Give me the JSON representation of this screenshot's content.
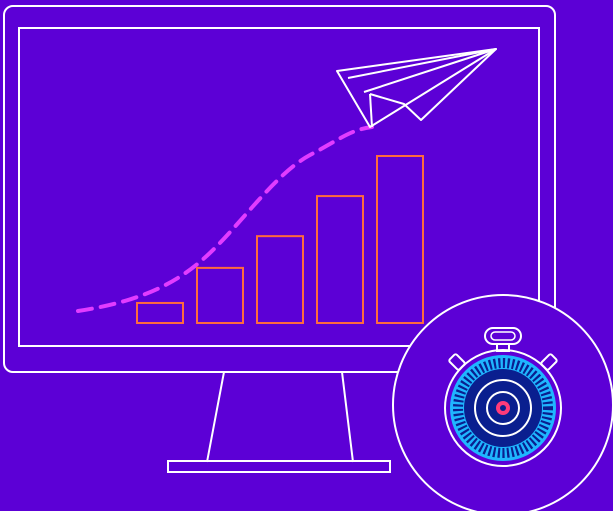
{
  "colors": {
    "background": "#5c00d6",
    "outline": "#ffffff",
    "bars": "#ff6a3d",
    "trend": "#e23cff",
    "dial_ring": "#1fb6ff",
    "dial_inner": "#0a1f8f",
    "center_dot": "#ff3b7a"
  },
  "icons": {
    "monitor": "monitor-icon",
    "bar_chart": "bar-chart-icon",
    "trend_line": "dashed-trend-line-icon",
    "paper_plane": "paper-plane-icon",
    "stopwatch": "stopwatch-icon"
  },
  "bars": [
    0.12,
    0.33,
    0.52,
    0.76,
    1.0
  ]
}
